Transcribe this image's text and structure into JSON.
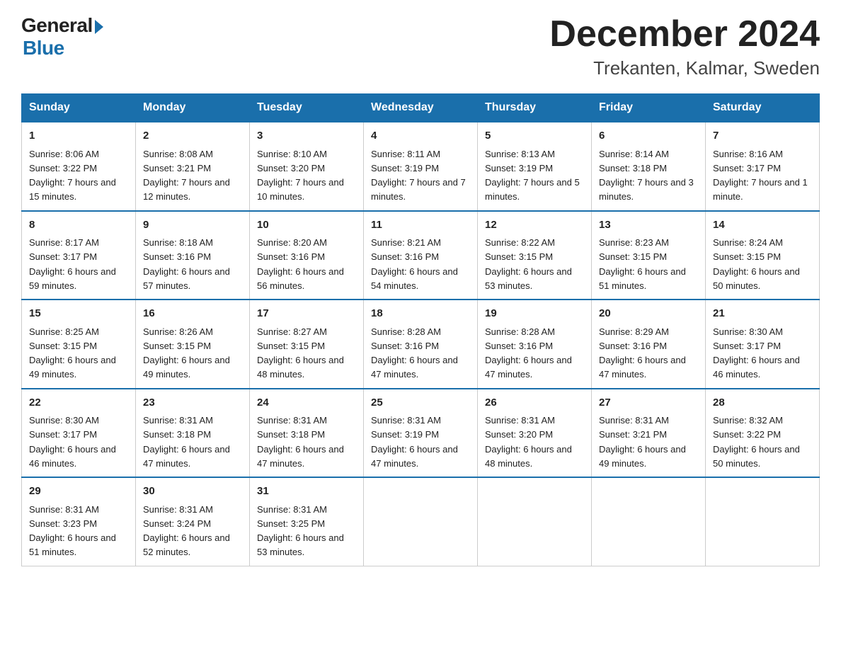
{
  "logo": {
    "general": "General",
    "blue": "Blue"
  },
  "title": "December 2024",
  "location": "Trekanten, Kalmar, Sweden",
  "days_of_week": [
    "Sunday",
    "Monday",
    "Tuesday",
    "Wednesday",
    "Thursday",
    "Friday",
    "Saturday"
  ],
  "weeks": [
    [
      {
        "day": "1",
        "sunrise": "Sunrise: 8:06 AM",
        "sunset": "Sunset: 3:22 PM",
        "daylight": "Daylight: 7 hours and 15 minutes."
      },
      {
        "day": "2",
        "sunrise": "Sunrise: 8:08 AM",
        "sunset": "Sunset: 3:21 PM",
        "daylight": "Daylight: 7 hours and 12 minutes."
      },
      {
        "day": "3",
        "sunrise": "Sunrise: 8:10 AM",
        "sunset": "Sunset: 3:20 PM",
        "daylight": "Daylight: 7 hours and 10 minutes."
      },
      {
        "day": "4",
        "sunrise": "Sunrise: 8:11 AM",
        "sunset": "Sunset: 3:19 PM",
        "daylight": "Daylight: 7 hours and 7 minutes."
      },
      {
        "day": "5",
        "sunrise": "Sunrise: 8:13 AM",
        "sunset": "Sunset: 3:19 PM",
        "daylight": "Daylight: 7 hours and 5 minutes."
      },
      {
        "day": "6",
        "sunrise": "Sunrise: 8:14 AM",
        "sunset": "Sunset: 3:18 PM",
        "daylight": "Daylight: 7 hours and 3 minutes."
      },
      {
        "day": "7",
        "sunrise": "Sunrise: 8:16 AM",
        "sunset": "Sunset: 3:17 PM",
        "daylight": "Daylight: 7 hours and 1 minute."
      }
    ],
    [
      {
        "day": "8",
        "sunrise": "Sunrise: 8:17 AM",
        "sunset": "Sunset: 3:17 PM",
        "daylight": "Daylight: 6 hours and 59 minutes."
      },
      {
        "day": "9",
        "sunrise": "Sunrise: 8:18 AM",
        "sunset": "Sunset: 3:16 PM",
        "daylight": "Daylight: 6 hours and 57 minutes."
      },
      {
        "day": "10",
        "sunrise": "Sunrise: 8:20 AM",
        "sunset": "Sunset: 3:16 PM",
        "daylight": "Daylight: 6 hours and 56 minutes."
      },
      {
        "day": "11",
        "sunrise": "Sunrise: 8:21 AM",
        "sunset": "Sunset: 3:16 PM",
        "daylight": "Daylight: 6 hours and 54 minutes."
      },
      {
        "day": "12",
        "sunrise": "Sunrise: 8:22 AM",
        "sunset": "Sunset: 3:15 PM",
        "daylight": "Daylight: 6 hours and 53 minutes."
      },
      {
        "day": "13",
        "sunrise": "Sunrise: 8:23 AM",
        "sunset": "Sunset: 3:15 PM",
        "daylight": "Daylight: 6 hours and 51 minutes."
      },
      {
        "day": "14",
        "sunrise": "Sunrise: 8:24 AM",
        "sunset": "Sunset: 3:15 PM",
        "daylight": "Daylight: 6 hours and 50 minutes."
      }
    ],
    [
      {
        "day": "15",
        "sunrise": "Sunrise: 8:25 AM",
        "sunset": "Sunset: 3:15 PM",
        "daylight": "Daylight: 6 hours and 49 minutes."
      },
      {
        "day": "16",
        "sunrise": "Sunrise: 8:26 AM",
        "sunset": "Sunset: 3:15 PM",
        "daylight": "Daylight: 6 hours and 49 minutes."
      },
      {
        "day": "17",
        "sunrise": "Sunrise: 8:27 AM",
        "sunset": "Sunset: 3:15 PM",
        "daylight": "Daylight: 6 hours and 48 minutes."
      },
      {
        "day": "18",
        "sunrise": "Sunrise: 8:28 AM",
        "sunset": "Sunset: 3:16 PM",
        "daylight": "Daylight: 6 hours and 47 minutes."
      },
      {
        "day": "19",
        "sunrise": "Sunrise: 8:28 AM",
        "sunset": "Sunset: 3:16 PM",
        "daylight": "Daylight: 6 hours and 47 minutes."
      },
      {
        "day": "20",
        "sunrise": "Sunrise: 8:29 AM",
        "sunset": "Sunset: 3:16 PM",
        "daylight": "Daylight: 6 hours and 47 minutes."
      },
      {
        "day": "21",
        "sunrise": "Sunrise: 8:30 AM",
        "sunset": "Sunset: 3:17 PM",
        "daylight": "Daylight: 6 hours and 46 minutes."
      }
    ],
    [
      {
        "day": "22",
        "sunrise": "Sunrise: 8:30 AM",
        "sunset": "Sunset: 3:17 PM",
        "daylight": "Daylight: 6 hours and 46 minutes."
      },
      {
        "day": "23",
        "sunrise": "Sunrise: 8:31 AM",
        "sunset": "Sunset: 3:18 PM",
        "daylight": "Daylight: 6 hours and 47 minutes."
      },
      {
        "day": "24",
        "sunrise": "Sunrise: 8:31 AM",
        "sunset": "Sunset: 3:18 PM",
        "daylight": "Daylight: 6 hours and 47 minutes."
      },
      {
        "day": "25",
        "sunrise": "Sunrise: 8:31 AM",
        "sunset": "Sunset: 3:19 PM",
        "daylight": "Daylight: 6 hours and 47 minutes."
      },
      {
        "day": "26",
        "sunrise": "Sunrise: 8:31 AM",
        "sunset": "Sunset: 3:20 PM",
        "daylight": "Daylight: 6 hours and 48 minutes."
      },
      {
        "day": "27",
        "sunrise": "Sunrise: 8:31 AM",
        "sunset": "Sunset: 3:21 PM",
        "daylight": "Daylight: 6 hours and 49 minutes."
      },
      {
        "day": "28",
        "sunrise": "Sunrise: 8:32 AM",
        "sunset": "Sunset: 3:22 PM",
        "daylight": "Daylight: 6 hours and 50 minutes."
      }
    ],
    [
      {
        "day": "29",
        "sunrise": "Sunrise: 8:31 AM",
        "sunset": "Sunset: 3:23 PM",
        "daylight": "Daylight: 6 hours and 51 minutes."
      },
      {
        "day": "30",
        "sunrise": "Sunrise: 8:31 AM",
        "sunset": "Sunset: 3:24 PM",
        "daylight": "Daylight: 6 hours and 52 minutes."
      },
      {
        "day": "31",
        "sunrise": "Sunrise: 8:31 AM",
        "sunset": "Sunset: 3:25 PM",
        "daylight": "Daylight: 6 hours and 53 minutes."
      },
      null,
      null,
      null,
      null
    ]
  ]
}
